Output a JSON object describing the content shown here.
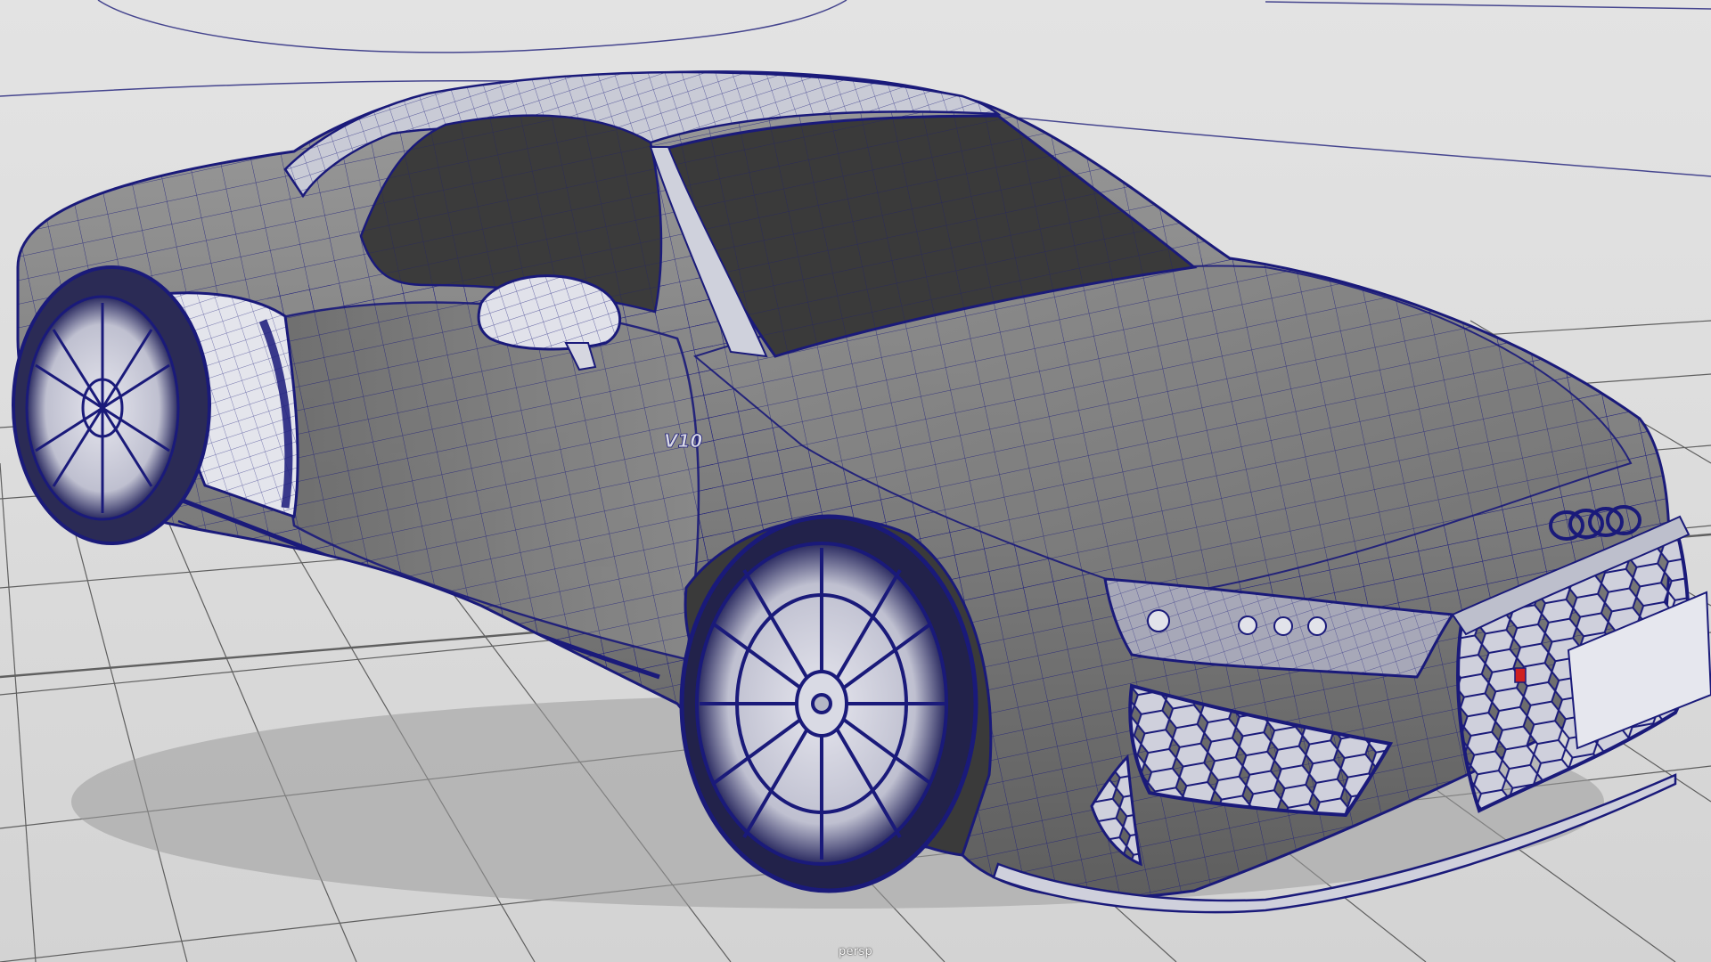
{
  "viewport": {
    "camera_label": "persp",
    "background_color": "#dcdcdc",
    "grid_color": "#4a4a4a",
    "wireframe_color": "#1a1a7a",
    "shaded_surface_color": "#7a7a7a",
    "glass_color": "#3a3a3a",
    "emblem_color": "#d02020"
  },
  "model": {
    "fender_badge_text": "V10"
  }
}
